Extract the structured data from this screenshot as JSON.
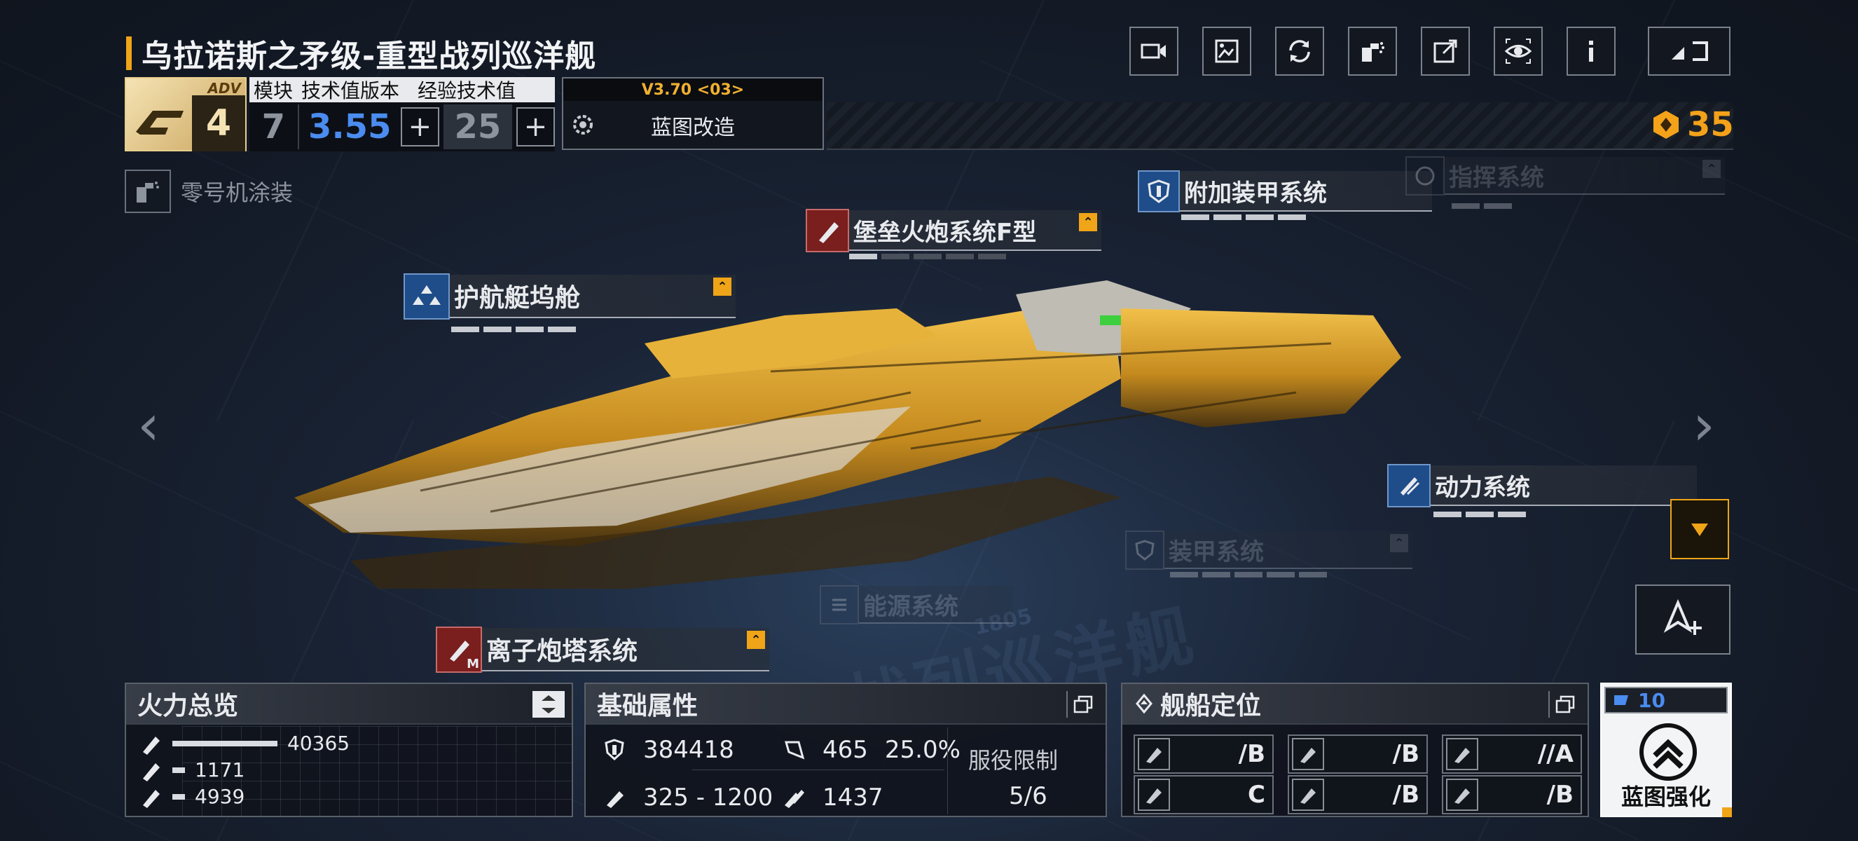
{
  "ship": {
    "title": "乌拉诺斯之矛级-重型战列巡洋舰"
  },
  "header": {
    "adv_tag": "ADV",
    "adv_level": "4",
    "col_module": "模块",
    "col_tech_version": "技术值版本",
    "col_exp_tech": "经验技术值",
    "module_value": "7",
    "tech_version_value": "3.55",
    "exp_tech_value": "25",
    "plus": "+",
    "version": "V3.70 <03>",
    "blueprint_mod": "蓝图改造",
    "currency": "35"
  },
  "skin": {
    "label": "零号机涂装"
  },
  "modules": {
    "escort_dock": "护航艇坞舱",
    "fortress_cannon": "堡垒火炮系统F型",
    "extra_armor": "附加装甲系统",
    "command": "指挥系统",
    "power": "动力系统",
    "armor": "装甲系统",
    "energy": "能源系统",
    "ion_turret": "离子炮塔系统",
    "ion_badge": "M"
  },
  "watermark": {
    "text": "战列巡洋舰",
    "num": "1805"
  },
  "firepower": {
    "title": "火力总览",
    "rows": [
      {
        "value": "40365",
        "fill": 1.0
      },
      {
        "value": "1171",
        "fill": 0.12
      },
      {
        "value": "4939",
        "fill": 0.12
      }
    ]
  },
  "attributes": {
    "title": "基础属性",
    "hp": "384418",
    "armor": "465",
    "armor_pct": "25.0%",
    "speed": "325 - 1200",
    "warp": "1437",
    "service_limit_label": "服役限制",
    "service_limit_value": "5/6"
  },
  "positioning": {
    "title": "舰船定位",
    "cells": [
      {
        "grade": "/B",
        "icon": "attack-icon"
      },
      {
        "grade": "/B",
        "icon": "anti-air-icon"
      },
      {
        "grade": "//A",
        "icon": "siege-icon"
      },
      {
        "grade": "C",
        "icon": "support-icon"
      },
      {
        "grade": "/B",
        "icon": "shield-icon"
      },
      {
        "grade": "/B",
        "icon": "repair-icon"
      }
    ]
  },
  "enhance": {
    "count": "10",
    "label": "蓝图强化"
  },
  "colors": {
    "accent": "#f0a418",
    "blue_value": "#4a8cf0",
    "ship_gold": "#d9a22c"
  }
}
